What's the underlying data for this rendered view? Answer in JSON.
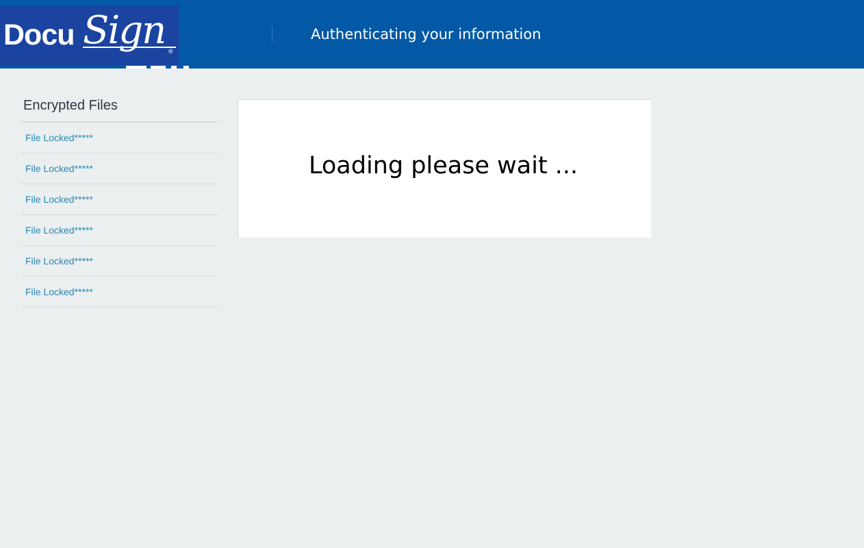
{
  "header": {
    "logo": {
      "docu_text": "Docu",
      "sign_text": "Sign",
      "registered_mark": "®"
    },
    "title": "Authenticating your information",
    "background_color": "#0359a6",
    "logo_background_color": "#1b43a0"
  },
  "sidebar": {
    "title": "Encrypted Files",
    "items": [
      {
        "label": "File Locked*****"
      },
      {
        "label": "File Locked*****"
      },
      {
        "label": "File Locked*****"
      },
      {
        "label": "File Locked*****"
      },
      {
        "label": "File Locked*****"
      },
      {
        "label": "File Locked*****"
      }
    ],
    "link_color": "#2a87b4"
  },
  "main": {
    "loading_text": "Loading please wait ..."
  },
  "page_background_color": "#ebeff0"
}
